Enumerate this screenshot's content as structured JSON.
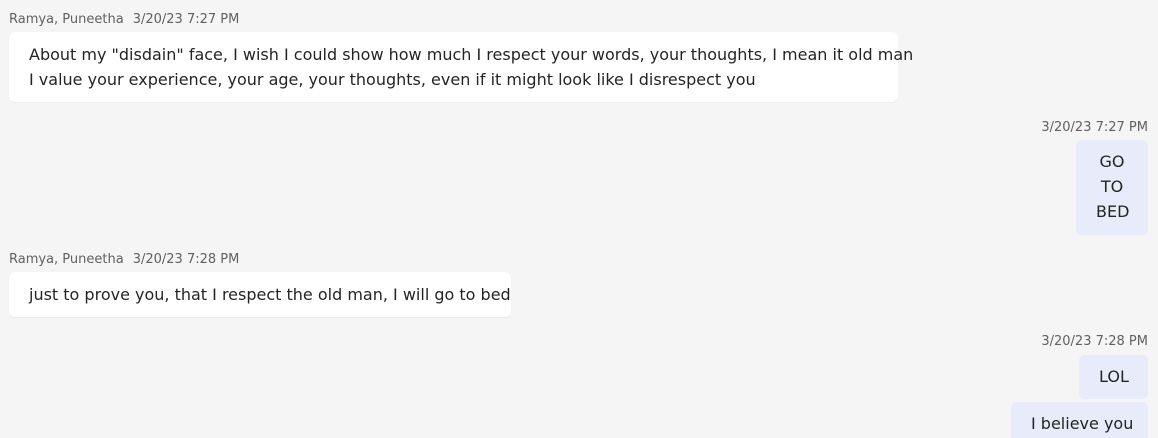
{
  "colors": {
    "background": "#f5f5f5",
    "incoming_bubble": "#ffffff",
    "outgoing_bubble": "#e8ebfa",
    "meta_text": "#616161",
    "body_text": "#242424"
  },
  "messages": [
    {
      "direction": "incoming",
      "sender": "Ramya, Puneetha",
      "timestamp": "3/20/23 7:27 PM",
      "lines": [
        "About my \"disdain\" face, I wish I could show how much I respect your words, your thoughts, I mean it old man",
        "I value your experience, your age, your thoughts, even if it might look like I disrespect you"
      ]
    },
    {
      "direction": "outgoing",
      "timestamp": "3/20/23 7:27 PM",
      "lines": [
        "GO",
        "TO",
        "BED"
      ]
    },
    {
      "direction": "incoming",
      "sender": "Ramya, Puneetha",
      "timestamp": "3/20/23 7:28 PM",
      "lines": [
        "just to prove you, that I respect the old man, I will go to bed"
      ]
    },
    {
      "direction": "outgoing",
      "timestamp": "3/20/23 7:28 PM",
      "lines": [
        "LOL"
      ]
    },
    {
      "direction": "outgoing",
      "lines": [
        "I believe you"
      ]
    }
  ]
}
